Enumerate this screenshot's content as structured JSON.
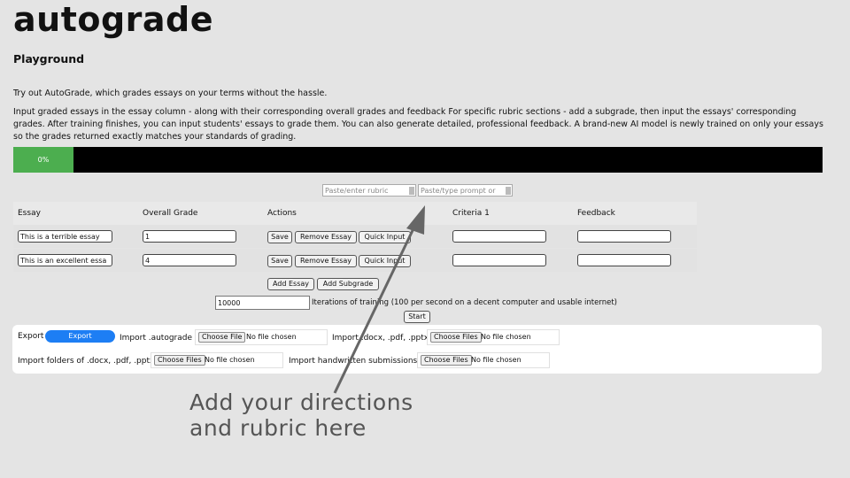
{
  "brand": "autograde",
  "subtitle": "Playground",
  "tagline": "Try out AutoGrade, which grades essays on your terms without the hassle.",
  "intro": "Input graded essays in the essay column - along with their corresponding overall grades and feedback For specific rubric sections - add a subgrade, then input the essays' corresponding grades. After training finishes, you can input students' essays to grade them. You can also generate detailed, professional feedback. A brand-new AI model is newly trained on only your essays so the grades returned exactly matches your standards of grading.",
  "progress": {
    "label": "0%",
    "value": 0
  },
  "rubric_placeholder": "Paste/enter rubric",
  "prompt_placeholder": "Paste/type prompt or",
  "table": {
    "headers": {
      "essay": "Essay",
      "overall": "Overall Grade",
      "actions": "Actions",
      "criteria": "Criteria 1",
      "feedback": "Feedback"
    },
    "rows": [
      {
        "essay": "This is a terrible essay",
        "grade": "1"
      },
      {
        "essay": "This is an excellent essa",
        "grade": "4"
      }
    ],
    "row_buttons": {
      "save": "Save",
      "remove": "Remove Essay",
      "quick": "Quick Input"
    },
    "add_essay": "Add Essay",
    "add_subgrade": "Add Subgrade"
  },
  "iterations": {
    "value": "10000",
    "label": "Iterations of training (100 per second on a decent computer and usable internet)",
    "start": "Start"
  },
  "io": {
    "export_label": "Export",
    "export_button": "Export",
    "import_autograde_label": "Import .autograde",
    "choose_file": "Choose File",
    "choose_files": "Choose Files",
    "no_file": "No file chosen",
    "import_docs_label": "Import .docx, .pdf, .pptx",
    "import_folders_label": "Import folders of .docx, .pdf, .pptx",
    "import_handwritten_label": "Import handwritten submissions"
  },
  "annotation": {
    "line1": "Add your directions",
    "line2": "and rubric here"
  },
  "colors": {
    "progress_fill": "#4cae4f",
    "export_button": "#1d7ef4",
    "background": "#e4e4e4"
  }
}
